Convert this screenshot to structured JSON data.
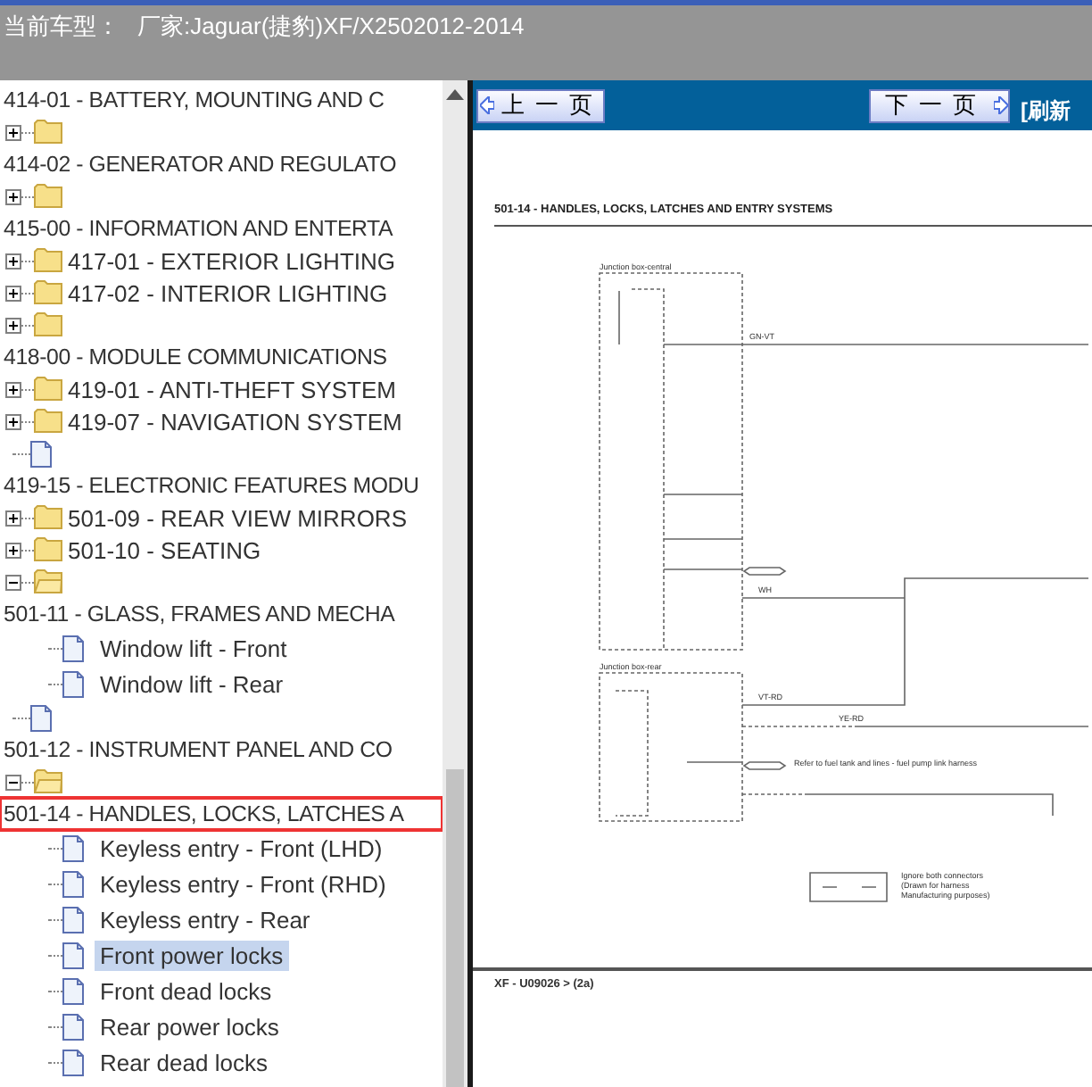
{
  "header": {
    "label": "当前车型：",
    "value": "厂家:Jaguar(捷豹)XF/X2502012-2014"
  },
  "tree": [
    {
      "kind": "heading",
      "label": "414-01 - BATTERY, MOUNTING AND C",
      "outlined": false
    },
    {
      "kind": "folder",
      "expanded": false
    },
    {
      "kind": "heading",
      "label": "414-02 - GENERATOR AND REGULATO",
      "outlined": false
    },
    {
      "kind": "folder",
      "expanded": false
    },
    {
      "kind": "heading",
      "label": "415-00 - INFORMATION AND ENTERTA",
      "outlined": false
    },
    {
      "kind": "folder",
      "expanded": false,
      "label": "417-01 - EXTERIOR LIGHTING"
    },
    {
      "kind": "folder",
      "expanded": false,
      "label": "417-02 - INTERIOR LIGHTING"
    },
    {
      "kind": "folder",
      "expanded": false
    },
    {
      "kind": "heading",
      "label": "418-00 - MODULE COMMUNICATIONS",
      "outlined": false
    },
    {
      "kind": "folder",
      "expanded": false,
      "label": "419-01 - ANTI-THEFT SYSTEM"
    },
    {
      "kind": "folder",
      "expanded": false,
      "label": "419-07 - NAVIGATION SYSTEM"
    },
    {
      "kind": "doc"
    },
    {
      "kind": "heading",
      "label": "419-15 - ELECTRONIC FEATURES MODU",
      "outlined": false
    },
    {
      "kind": "folder",
      "expanded": false,
      "label": "501-09 - REAR VIEW MIRRORS"
    },
    {
      "kind": "folder",
      "expanded": false,
      "label": "501-10 - SEATING"
    },
    {
      "kind": "folder",
      "expanded": true
    },
    {
      "kind": "heading",
      "label": "501-11 - GLASS, FRAMES AND MECHA",
      "outlined": false,
      "children": [
        {
          "kind": "doc",
          "label": "Window lift - Front",
          "selected": false
        },
        {
          "kind": "doc",
          "label": "Window lift - Rear",
          "selected": false
        }
      ]
    },
    {
      "kind": "doc"
    },
    {
      "kind": "heading",
      "label": "501-12 - INSTRUMENT PANEL AND CO",
      "outlined": false
    },
    {
      "kind": "folder",
      "expanded": true
    },
    {
      "kind": "heading",
      "label": "501-14 - HANDLES, LOCKS, LATCHES A",
      "outlined": true,
      "children": [
        {
          "kind": "doc",
          "label": "Keyless entry - Front (LHD)",
          "selected": false
        },
        {
          "kind": "doc",
          "label": "Keyless entry - Front (RHD)",
          "selected": false
        },
        {
          "kind": "doc",
          "label": "Keyless entry - Rear",
          "selected": false
        },
        {
          "kind": "doc",
          "label": "Front power locks",
          "selected": true
        },
        {
          "kind": "doc",
          "label": "Front dead locks",
          "selected": false
        },
        {
          "kind": "doc",
          "label": "Rear power locks",
          "selected": false
        },
        {
          "kind": "doc",
          "label": "Rear dead locks",
          "selected": false
        }
      ]
    }
  ],
  "viewer": {
    "prev_button": "上一页",
    "next_button": "下一页",
    "refresh_link": "[刷新",
    "document": {
      "title": "501-14 - HANDLES, LOCKS, LATCHES AND ENTRY SYSTEMS",
      "diagram_labels": [
        "Junction box-central",
        "GN-VT",
        "WH",
        "Junction box-rear",
        "VT-RD",
        "YE-RD",
        "Refer to fuel tank and lines - fuel pump link harness",
        "Ignore both connectors",
        "(Drawn for harness",
        "Manufacturing purposes)"
      ],
      "footer": "XF - U09026 > (2a)"
    }
  }
}
